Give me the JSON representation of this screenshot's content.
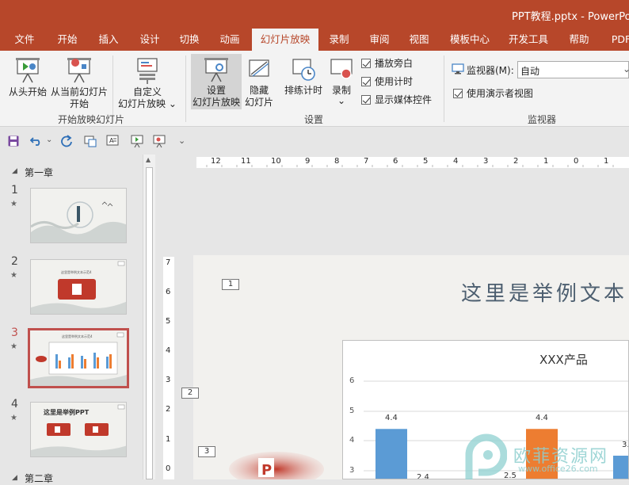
{
  "window": {
    "title": "PPT教程.pptx  -  PowerPoi"
  },
  "tabs": [
    {
      "label": "文件"
    },
    {
      "label": "开始"
    },
    {
      "label": "插入"
    },
    {
      "label": "设计"
    },
    {
      "label": "切换"
    },
    {
      "label": "动画"
    },
    {
      "label": "幻灯片放映"
    },
    {
      "label": "录制"
    },
    {
      "label": "审阅"
    },
    {
      "label": "视图"
    },
    {
      "label": "模板中心"
    },
    {
      "label": "开发工具"
    },
    {
      "label": "帮助"
    },
    {
      "label": "PDF"
    }
  ],
  "active_tab": "幻灯片放映",
  "ribbon": {
    "group1": {
      "label": "开始放映幻灯片",
      "from_start": "从头开始",
      "from_current_1": "从当前幻灯片",
      "from_current_2": "开始",
      "custom_1": "自定义",
      "custom_2": "幻灯片放映",
      "custom_chevron": "⌄"
    },
    "group2": {
      "label": "设置",
      "setup_1": "设置",
      "setup_2": "幻灯片放映",
      "hide_1": "隐藏",
      "hide_2": "幻灯片",
      "rehearse": "排练计时",
      "record": "录制",
      "record_chevron": "⌄",
      "chk_narration": "播放旁白",
      "chk_timings": "使用计时",
      "chk_media": "显示媒体控件"
    },
    "group3": {
      "label": "监视器",
      "monitor_label": "监视器(M):",
      "monitor_value": "自动",
      "presenter_view": "使用演示者视图"
    }
  },
  "qat": {
    "more": "⌄"
  },
  "outline": {
    "section1": "第一章",
    "section2": "第二章",
    "slides": [
      {
        "num": "1",
        "star": "★"
      },
      {
        "num": "2",
        "star": "★"
      },
      {
        "num": "3",
        "star": "★"
      },
      {
        "num": "4",
        "star": "★"
      }
    ],
    "thumb2_title": "这里是举例文本示范4",
    "thumb3_title": "这里是举例文本示范4",
    "thumb4_title": "这里是举例PPT"
  },
  "rulers": {
    "h_labels": [
      "12",
      "11",
      "10",
      "9",
      "8",
      "7",
      "6",
      "5",
      "4",
      "3",
      "2",
      "1",
      "0",
      "1"
    ],
    "v_labels": [
      "7",
      "6",
      "5",
      "4",
      "3",
      "2",
      "1",
      "0"
    ]
  },
  "slide": {
    "title": "这里是举例文本",
    "placeholders": [
      "1",
      "2",
      "3"
    ]
  },
  "watermark": {
    "text": "欧菲资源网",
    "url": "www.office26.com"
  },
  "colors": {
    "accent": "#b7472a",
    "bar_blue": "#5b9bd5",
    "bar_orange": "#ed7d31",
    "selected_border": "#c0504d"
  },
  "chart_data": {
    "type": "bar",
    "title": "XXX产品",
    "ylim": [
      3,
      6
    ],
    "yticks": [
      "6",
      "5",
      "4",
      "3"
    ],
    "series": [
      {
        "color": "#5b9bd5",
        "values": [
          4.4
        ]
      },
      {
        "color": "#ed7d31",
        "values": [
          4.4
        ]
      }
    ],
    "data_labels": [
      "4.4",
      "2.4",
      "2.5",
      "4.4",
      "3."
    ]
  }
}
